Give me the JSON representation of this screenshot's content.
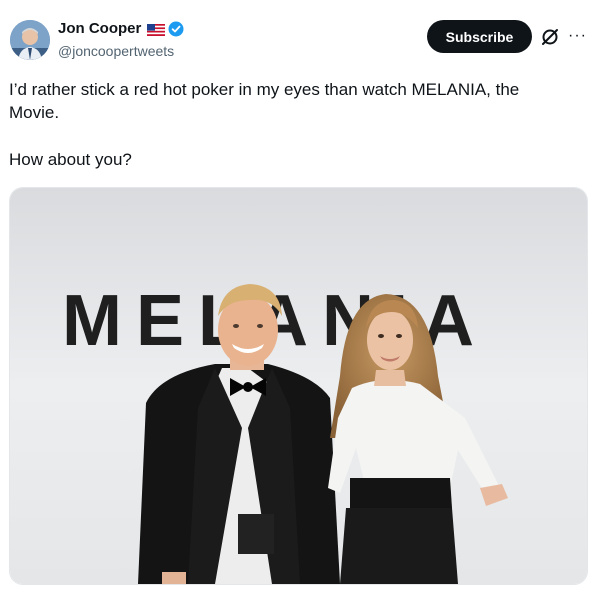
{
  "author": {
    "display_name": "Jon Cooper",
    "handle": "@joncoopertweets",
    "flag_icon": "us-flag-icon",
    "badge_icon": "verified-badge-icon",
    "badge_color": "#1d9bf0"
  },
  "actions": {
    "subscribe_label": "Subscribe",
    "grok_icon": "grok-icon",
    "more_label": "···"
  },
  "post": {
    "line1": "I’d rather stick a red hot poker in my eyes than watch MELANIA, the Movie.",
    "line2": "How about you?"
  },
  "media": {
    "backdrop_text": "MELANIA"
  }
}
